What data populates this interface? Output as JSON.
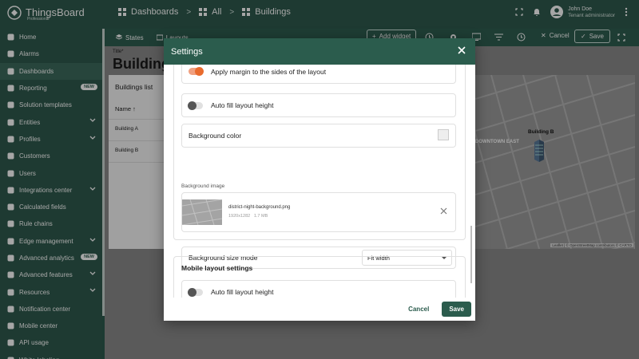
{
  "app": {
    "name": "ThingsBoard",
    "edition": "Professional"
  },
  "breadcrumbs": [
    "Dashboards",
    "All",
    "Buildings"
  ],
  "user": {
    "name": "John Doe",
    "role": "Tenant administrator"
  },
  "sidebar": {
    "items": [
      {
        "label": "Home",
        "icon": "home-icon"
      },
      {
        "label": "Alarms",
        "icon": "alarm-icon"
      },
      {
        "label": "Dashboards",
        "icon": "dashboard-icon",
        "active": true
      },
      {
        "label": "Reporting",
        "icon": "report-icon",
        "badge": "NEW"
      },
      {
        "label": "Solution templates",
        "icon": "template-icon"
      },
      {
        "label": "Entities",
        "icon": "entities-icon",
        "expandable": true
      },
      {
        "label": "Profiles",
        "icon": "profiles-icon",
        "expandable": true
      },
      {
        "label": "Customers",
        "icon": "customers-icon"
      },
      {
        "label": "Users",
        "icon": "users-icon"
      },
      {
        "label": "Integrations center",
        "icon": "integrations-icon",
        "expandable": true
      },
      {
        "label": "Calculated fields",
        "icon": "calc-icon"
      },
      {
        "label": "Rule chains",
        "icon": "rule-chain-icon"
      },
      {
        "label": "Edge management",
        "icon": "edge-icon",
        "expandable": true
      },
      {
        "label": "Advanced analytics",
        "icon": "analytics-icon",
        "badge": "NEW"
      },
      {
        "label": "Advanced features",
        "icon": "features-icon",
        "expandable": true
      },
      {
        "label": "Resources",
        "icon": "resources-icon",
        "expandable": true
      },
      {
        "label": "Notification center",
        "icon": "notification-icon"
      },
      {
        "label": "Mobile center",
        "icon": "mobile-icon"
      },
      {
        "label": "API usage",
        "icon": "api-icon"
      },
      {
        "label": "White labeling",
        "icon": "white-label-icon"
      }
    ]
  },
  "toolbar": {
    "states": "States",
    "layouts": "Layouts",
    "add_widget": "Add widget",
    "cancel": "Cancel",
    "save": "Save"
  },
  "dashboard": {
    "title_label": "Title*",
    "title": "Buildings",
    "list_title": "Buildings list",
    "column_name": "Name",
    "rows": [
      "Building A",
      "Building B"
    ],
    "map_marker": "Building B",
    "map_district": "DOWNTOWN EAST",
    "map_attribution": "Leaflet | © OpenStreetMap contributors © CARTO"
  },
  "modal": {
    "title": "Settings",
    "apply_margin": "Apply margin to the sides of the layout",
    "auto_fill": "Auto fill layout height",
    "background_color": "Background color",
    "background_image_label": "Background image",
    "file_name": "district-night-background.png",
    "file_dims": "1920x1282",
    "file_size": "1.7 MB",
    "bg_size_mode_label": "Background size mode",
    "bg_size_mode_value": "Fit width",
    "mobile_section": "Mobile layout settings",
    "mobile_auto_fill": "Auto fill layout height",
    "cancel": "Cancel",
    "save": "Save"
  }
}
